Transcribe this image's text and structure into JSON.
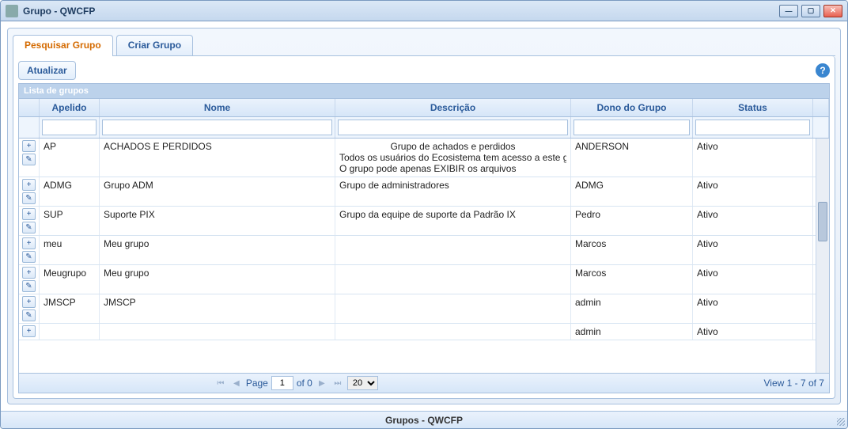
{
  "window": {
    "title": "Grupo - QWCFP",
    "footer": "Grupos - QWCFP"
  },
  "tabs": [
    {
      "label": "Pesquisar Grupo",
      "active": true
    },
    {
      "label": "Criar Grupo",
      "active": false
    }
  ],
  "actions": {
    "refresh": "Atualizar"
  },
  "grid": {
    "caption": "Lista de grupos",
    "headers": {
      "apelido": "Apelido",
      "nome": "Nome",
      "descricao": "Descrição",
      "dono": "Dono do Grupo",
      "status": "Status"
    },
    "filters": {
      "apelido": "",
      "nome": "",
      "descricao": "",
      "dono": "",
      "status": ""
    },
    "rows": [
      {
        "apelido": "AP",
        "nome": "ACHADOS E PERDIDOS",
        "descricao": [
          "Grupo de achados e perdidos",
          "Todos os usuários do Ecosistema tem acesso a este gr",
          "O grupo pode apenas EXIBIR os arquivos"
        ],
        "desc_center_first": true,
        "dono": "ANDERSON",
        "status": "Ativo"
      },
      {
        "apelido": "ADMG",
        "nome": "Grupo ADM",
        "descricao": [
          "Grupo de administradores"
        ],
        "dono": "ADMG",
        "status": "Ativo"
      },
      {
        "apelido": "SUP",
        "nome": "Suporte PIX",
        "descricao": [
          "Grupo da equipe de suporte da Padrão IX"
        ],
        "dono": "Pedro",
        "status": "Ativo"
      },
      {
        "apelido": "meu",
        "nome": "Meu grupo",
        "descricao": [
          ""
        ],
        "dono": "Marcos",
        "status": "Ativo"
      },
      {
        "apelido": "Meugrupo",
        "nome": "Meu grupo",
        "descricao": [
          ""
        ],
        "dono": "Marcos",
        "status": "Ativo"
      },
      {
        "apelido": "JMSCP",
        "nome": "JMSCP",
        "descricao": [
          ""
        ],
        "dono": "admin",
        "status": "Ativo"
      },
      {
        "apelido": "",
        "nome": "",
        "descricao": [
          ""
        ],
        "dono": "admin",
        "status": "Ativo",
        "partial": true
      }
    ]
  },
  "pager": {
    "page_label": "Page",
    "page_value": "1",
    "of_label": "of 0",
    "rows_per_page": "20",
    "view_label": "View 1 - 7 of 7"
  }
}
